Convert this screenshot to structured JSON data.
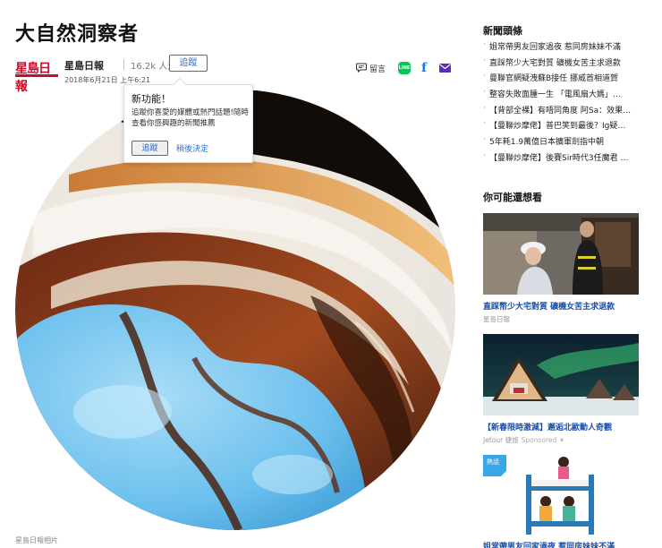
{
  "article": {
    "title": "大自然洞察者",
    "publisher": {
      "logo_text": "星島日報",
      "name": "星島日報",
      "followers": "16.2k 人追蹤",
      "follow_label": "追蹤",
      "date": "2018年6月21日 上午6:21"
    },
    "share": {
      "comment_label": "留言",
      "line_label": "LINE"
    },
    "photo_caption": "星島日報相片"
  },
  "popover": {
    "title": "新功能！",
    "body": "追蹤你喜愛的媒體或熱門話題!隨時查看你感興趣的新聞推薦",
    "follow_label": "追蹤",
    "later_label": "稍後決定"
  },
  "sidebar": {
    "news_heading": "新聞頭條",
    "news": [
      "姐常帶男友回家過夜 惹同房妹妹不滿",
      "直踩幣少大宅對質 礦機女苦主求退款",
      "曼聯官網疑洩蘇B接任 挪威首相道賀",
      "整容失敗面腫一生 「電風扇大媽」…",
      "【背部全裸】有唔同角度 阿Sa：效果…",
      "【曼聯炒摩佬】普巴笑到最後？Ig疑…",
      "5年耗1.9萬億日本擴軍劍指中朝",
      "【曼聯炒摩佬】後賽Sir時代3任魔君 …"
    ],
    "recommend_heading": "你可能還想看",
    "cards": [
      {
        "title": "直踩幣少大宅對質 礦機女苦主求退款",
        "source": "星島日報",
        "sponsored": ""
      },
      {
        "title": "【新春限時激減】邂逅北歐動人奇觀",
        "source": "Jetour 捷旅",
        "sponsored": "Sponsored"
      },
      {
        "badge": "熱話",
        "title": "姐常帶男友回家過夜 惹同房妹妹不滿"
      }
    ]
  },
  "colors": {
    "accent_blue": "#2f6fd0",
    "link_blue": "#1a4fa8",
    "brand_red": "#c8102e"
  }
}
